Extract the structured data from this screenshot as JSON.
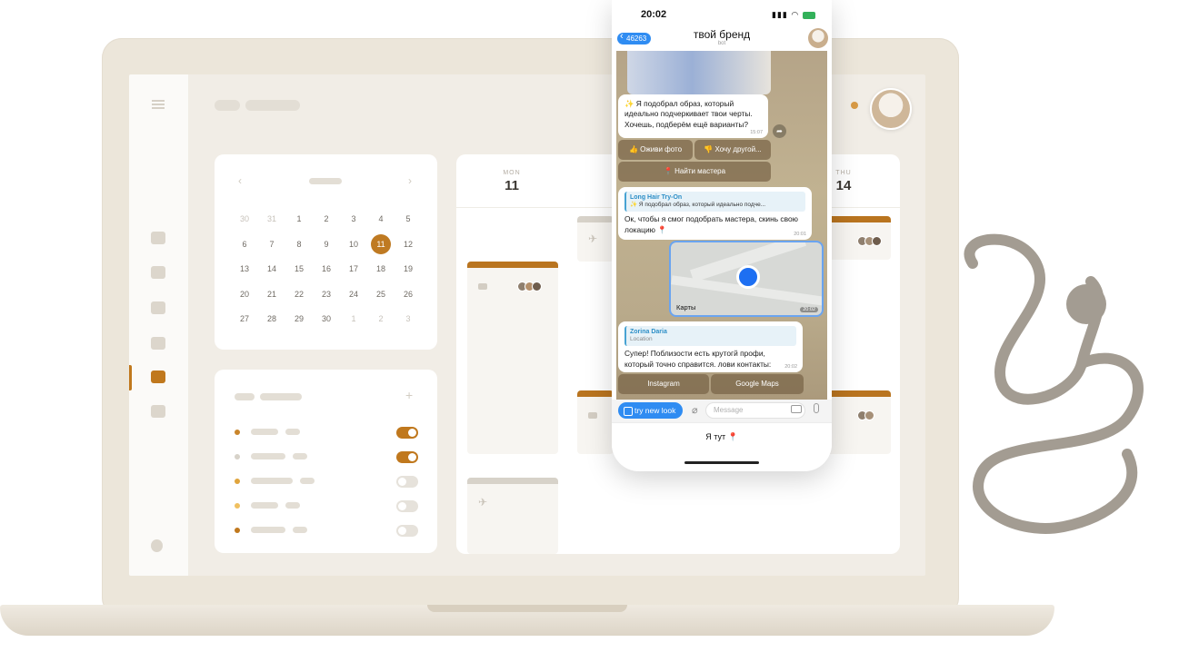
{
  "calendar": {
    "selected_day": "11",
    "days": [
      {
        "d": "30",
        "dim": true
      },
      {
        "d": "31",
        "dim": true
      },
      {
        "d": "1"
      },
      {
        "d": "2"
      },
      {
        "d": "3"
      },
      {
        "d": "4"
      },
      {
        "d": "5"
      },
      {
        "d": "6"
      },
      {
        "d": "7"
      },
      {
        "d": "8"
      },
      {
        "d": "9"
      },
      {
        "d": "10"
      },
      {
        "d": "11",
        "sel": true
      },
      {
        "d": "12"
      },
      {
        "d": "13"
      },
      {
        "d": "14"
      },
      {
        "d": "15"
      },
      {
        "d": "16"
      },
      {
        "d": "17"
      },
      {
        "d": "18"
      },
      {
        "d": "19"
      },
      {
        "d": "20"
      },
      {
        "d": "21"
      },
      {
        "d": "22"
      },
      {
        "d": "23"
      },
      {
        "d": "24"
      },
      {
        "d": "25"
      },
      {
        "d": "26"
      },
      {
        "d": "27"
      },
      {
        "d": "28"
      },
      {
        "d": "29"
      },
      {
        "d": "30"
      },
      {
        "d": "1",
        "dim": true
      },
      {
        "d": "2",
        "dim": true
      },
      {
        "d": "3",
        "dim": true
      }
    ],
    "prev_arrow": "‹",
    "next_arrow": "›"
  },
  "toggles": [
    {
      "dot": "#c9852b",
      "on": true
    },
    {
      "dot": "#d7d2c9",
      "on": true
    },
    {
      "dot": "#e0a43c",
      "on": false
    },
    {
      "dot": "#f0c060",
      "on": false
    },
    {
      "dot": "#c0781d",
      "on": false
    }
  ],
  "schedule": {
    "day1": {
      "label": "MON",
      "num": "11"
    },
    "day2": {
      "label": "THU",
      "num": "14"
    }
  },
  "phone": {
    "status_time": "20:02",
    "back_count": "46263",
    "chat_title": "твой бренд",
    "chat_subtitle": "bot",
    "msg1": "✨ Я подобрал образ, который идеально подчеркивает твои черты. Хочешь, подберём ещё варианты?",
    "msg1_time": "15:07",
    "btn_animate": "👍 Оживи фото",
    "btn_other": "👎 Хочу другой...",
    "btn_master": "📍 Найти мастера",
    "reply1_name": "Long Hair Try-On",
    "reply1_text": "✨ Я подобрал образ, который идеально подче...",
    "msg2": "Ок, чтобы я смог подобрать мастера, скинь свою локацию 📍",
    "msg2_time": "20:01",
    "map_label": "Карты",
    "map_time": "20:02",
    "reply2_name": "Zorina Daria",
    "reply2_text": "Location",
    "msg3": "Супер! Поблизости есть крутогй профи, который точно справится. лови контакты:",
    "msg3_time": "20:02",
    "btn_instagram": "Instagram",
    "btn_gmaps": "Google Maps",
    "try_label": "try new look",
    "message_placeholder": "Message",
    "bottom_button": "Я тут 📍"
  },
  "colors": {
    "accent": "#c0781d",
    "phone_blue": "#2f8cf2"
  }
}
